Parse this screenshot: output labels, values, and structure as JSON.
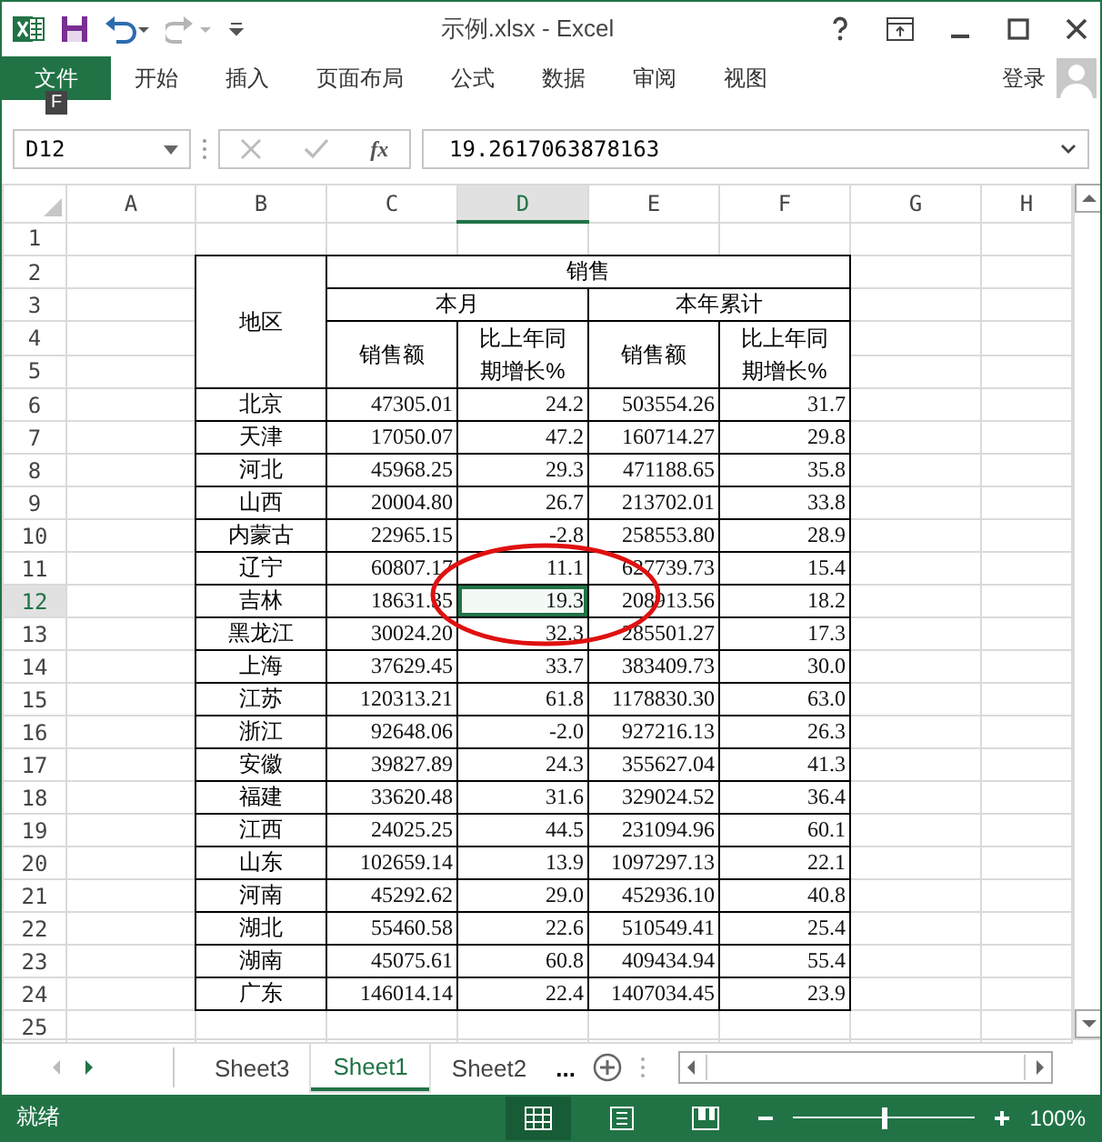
{
  "window": {
    "title": "示例.xlsx - Excel"
  },
  "ribbon": {
    "tabs": [
      {
        "label": "文件",
        "kind": "file",
        "selected": false
      },
      {
        "label": "开始",
        "kind": "tab",
        "selected": false
      },
      {
        "label": "插入",
        "kind": "tab",
        "selected": false
      },
      {
        "label": "页面布局",
        "kind": "tab",
        "selected": false
      },
      {
        "label": "公式",
        "kind": "tab",
        "selected": false
      },
      {
        "label": "数据",
        "kind": "tab",
        "selected": false
      },
      {
        "label": "审阅",
        "kind": "tab",
        "selected": false
      },
      {
        "label": "视图",
        "kind": "tab",
        "selected": false
      }
    ],
    "keytip": "F",
    "sign_in": "登录"
  },
  "formula_bar": {
    "name_box": "D12",
    "fx": "fx",
    "formula": "19.2617063878163"
  },
  "sheet": {
    "columns": [
      {
        "label": "A",
        "selected": false
      },
      {
        "label": "B",
        "selected": false
      },
      {
        "label": "C",
        "selected": false
      },
      {
        "label": "D",
        "selected": true
      },
      {
        "label": "E",
        "selected": false
      },
      {
        "label": "F",
        "selected": false
      },
      {
        "label": "G",
        "selected": false
      },
      {
        "label": "H",
        "selected": false
      }
    ],
    "row_numbers": [
      {
        "label": "1",
        "selected": false
      },
      {
        "label": "2",
        "selected": false
      },
      {
        "label": "3",
        "selected": false
      },
      {
        "label": "4",
        "selected": false
      },
      {
        "label": "5",
        "selected": false
      },
      {
        "label": "6",
        "selected": false
      },
      {
        "label": "7",
        "selected": false
      },
      {
        "label": "8",
        "selected": false
      },
      {
        "label": "9",
        "selected": false
      },
      {
        "label": "10",
        "selected": false
      },
      {
        "label": "11",
        "selected": false
      },
      {
        "label": "12",
        "selected": true
      },
      {
        "label": "13",
        "selected": false
      },
      {
        "label": "14",
        "selected": false
      },
      {
        "label": "15",
        "selected": false
      },
      {
        "label": "16",
        "selected": false
      },
      {
        "label": "17",
        "selected": false
      },
      {
        "label": "18",
        "selected": false
      },
      {
        "label": "19",
        "selected": false
      },
      {
        "label": "20",
        "selected": false
      },
      {
        "label": "21",
        "selected": false
      },
      {
        "label": "22",
        "selected": false
      },
      {
        "label": "23",
        "selected": false
      },
      {
        "label": "24",
        "selected": false
      },
      {
        "label": "25",
        "selected": false
      }
    ],
    "header": {
      "region": "地区",
      "sales": "销售",
      "this_month": "本月",
      "year_to_date": "本年累计",
      "month_amount": "销售额",
      "month_growth": "比上年同期增长%",
      "year_amount": "销售额",
      "year_growth": "比上年同期增长%"
    },
    "data": [
      {
        "region": "北京",
        "cells": [
          {
            "value": "47305.01",
            "selected": false
          },
          {
            "value": "24.2",
            "selected": false
          },
          {
            "value": "503554.26",
            "selected": false
          },
          {
            "value": "31.7",
            "selected": false
          }
        ]
      },
      {
        "region": "天津",
        "cells": [
          {
            "value": "17050.07",
            "selected": false
          },
          {
            "value": "47.2",
            "selected": false
          },
          {
            "value": "160714.27",
            "selected": false
          },
          {
            "value": "29.8",
            "selected": false
          }
        ]
      },
      {
        "region": "河北",
        "cells": [
          {
            "value": "45968.25",
            "selected": false
          },
          {
            "value": "29.3",
            "selected": false
          },
          {
            "value": "471188.65",
            "selected": false
          },
          {
            "value": "35.8",
            "selected": false
          }
        ]
      },
      {
        "region": "山西",
        "cells": [
          {
            "value": "20004.80",
            "selected": false
          },
          {
            "value": "26.7",
            "selected": false
          },
          {
            "value": "213702.01",
            "selected": false
          },
          {
            "value": "33.8",
            "selected": false
          }
        ]
      },
      {
        "region": "内蒙古",
        "cells": [
          {
            "value": "22965.15",
            "selected": false
          },
          {
            "value": "-2.8",
            "selected": false
          },
          {
            "value": "258553.80",
            "selected": false
          },
          {
            "value": "28.9",
            "selected": false
          }
        ]
      },
      {
        "region": "辽宁",
        "cells": [
          {
            "value": "60807.17",
            "selected": false
          },
          {
            "value": "11.1",
            "selected": false
          },
          {
            "value": "627739.73",
            "selected": false
          },
          {
            "value": "15.4",
            "selected": false
          }
        ]
      },
      {
        "region": "吉林",
        "cells": [
          {
            "value": "18631.35",
            "selected": false
          },
          {
            "value": "19.3",
            "selected": true
          },
          {
            "value": "208913.56",
            "selected": false
          },
          {
            "value": "18.2",
            "selected": false
          }
        ]
      },
      {
        "region": "黑龙江",
        "cells": [
          {
            "value": "30024.20",
            "selected": false
          },
          {
            "value": "32.3",
            "selected": false
          },
          {
            "value": "285501.27",
            "selected": false
          },
          {
            "value": "17.3",
            "selected": false
          }
        ]
      },
      {
        "region": "上海",
        "cells": [
          {
            "value": "37629.45",
            "selected": false
          },
          {
            "value": "33.7",
            "selected": false
          },
          {
            "value": "383409.73",
            "selected": false
          },
          {
            "value": "30.0",
            "selected": false
          }
        ]
      },
      {
        "region": "江苏",
        "cells": [
          {
            "value": "120313.21",
            "selected": false
          },
          {
            "value": "61.8",
            "selected": false
          },
          {
            "value": "1178830.30",
            "selected": false
          },
          {
            "value": "63.0",
            "selected": false
          }
        ]
      },
      {
        "region": "浙江",
        "cells": [
          {
            "value": "92648.06",
            "selected": false
          },
          {
            "value": "-2.0",
            "selected": false
          },
          {
            "value": "927216.13",
            "selected": false
          },
          {
            "value": "26.3",
            "selected": false
          }
        ]
      },
      {
        "region": "安徽",
        "cells": [
          {
            "value": "39827.89",
            "selected": false
          },
          {
            "value": "24.3",
            "selected": false
          },
          {
            "value": "355627.04",
            "selected": false
          },
          {
            "value": "41.3",
            "selected": false
          }
        ]
      },
      {
        "region": "福建",
        "cells": [
          {
            "value": "33620.48",
            "selected": false
          },
          {
            "value": "31.6",
            "selected": false
          },
          {
            "value": "329024.52",
            "selected": false
          },
          {
            "value": "36.4",
            "selected": false
          }
        ]
      },
      {
        "region": "江西",
        "cells": [
          {
            "value": "24025.25",
            "selected": false
          },
          {
            "value": "44.5",
            "selected": false
          },
          {
            "value": "231094.96",
            "selected": false
          },
          {
            "value": "60.1",
            "selected": false
          }
        ]
      },
      {
        "region": "山东",
        "cells": [
          {
            "value": "102659.14",
            "selected": false
          },
          {
            "value": "13.9",
            "selected": false
          },
          {
            "value": "1097297.13",
            "selected": false
          },
          {
            "value": "22.1",
            "selected": false
          }
        ]
      },
      {
        "region": "河南",
        "cells": [
          {
            "value": "45292.62",
            "selected": false
          },
          {
            "value": "29.0",
            "selected": false
          },
          {
            "value": "452936.10",
            "selected": false
          },
          {
            "value": "40.8",
            "selected": false
          }
        ]
      },
      {
        "region": "湖北",
        "cells": [
          {
            "value": "55460.58",
            "selected": false
          },
          {
            "value": "22.6",
            "selected": false
          },
          {
            "value": "510549.41",
            "selected": false
          },
          {
            "value": "25.4",
            "selected": false
          }
        ]
      },
      {
        "region": "湖南",
        "cells": [
          {
            "value": "45075.61",
            "selected": false
          },
          {
            "value": "60.8",
            "selected": false
          },
          {
            "value": "409434.94",
            "selected": false
          },
          {
            "value": "55.4",
            "selected": false
          }
        ]
      },
      {
        "region": "广东",
        "cells": [
          {
            "value": "146014.14",
            "selected": false
          },
          {
            "value": "22.4",
            "selected": false
          },
          {
            "value": "1407034.45",
            "selected": false
          },
          {
            "value": "23.9",
            "selected": false
          }
        ]
      }
    ]
  },
  "sheet_tabs": {
    "tabs": [
      {
        "label": "Sheet3",
        "selected": false
      },
      {
        "label": "Sheet1",
        "selected": true
      },
      {
        "label": "Sheet2",
        "selected": false
      }
    ],
    "more": "..."
  },
  "status_bar": {
    "status": "就绪",
    "views": [
      {
        "kind": "normal",
        "selected": true
      },
      {
        "kind": "page_layout",
        "selected": false
      },
      {
        "kind": "page_break",
        "selected": false
      }
    ],
    "zoom": {
      "level": 0.5,
      "reading": "100%"
    }
  }
}
